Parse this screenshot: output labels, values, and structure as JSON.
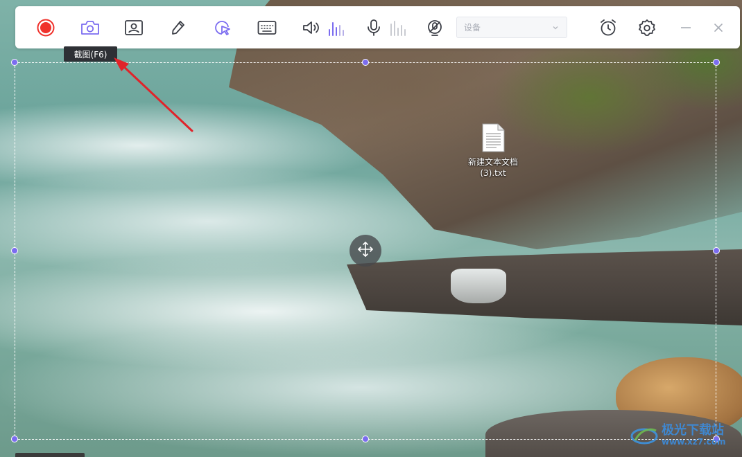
{
  "toolbar": {
    "buttons": [
      {
        "id": "record",
        "icon": "record-icon"
      },
      {
        "id": "screenshot",
        "icon": "camera-icon"
      },
      {
        "id": "webcam",
        "icon": "webcam-icon"
      },
      {
        "id": "draw",
        "icon": "pen-icon"
      },
      {
        "id": "cursor",
        "icon": "cursor-click-icon"
      },
      {
        "id": "keyboard",
        "icon": "keyboard-icon"
      },
      {
        "id": "system_audio",
        "icon": "speaker-icon"
      },
      {
        "id": "microphone",
        "icon": "microphone-icon"
      },
      {
        "id": "mic_device",
        "icon": "mic-disabled-icon"
      },
      {
        "id": "timer",
        "icon": "alarm-clock-icon"
      },
      {
        "id": "settings",
        "icon": "gear-icon"
      },
      {
        "id": "minimize",
        "icon": "minimize-icon"
      },
      {
        "id": "close",
        "icon": "close-icon"
      }
    ],
    "device_select": {
      "value": "设备",
      "icon": "chevron-down-icon"
    },
    "accent_color": "#7b6cf0",
    "record_color": "#f0322c",
    "icon_color": "#3a3d45"
  },
  "tooltip": {
    "text": "截图(F6)"
  },
  "desktop_icon": {
    "filename": "新建文本文档(3).txt",
    "icon": "text-file-icon"
  },
  "watermark": {
    "title": "极光下载站",
    "url": "www.xz7.com"
  },
  "annotation_color": "#e0232a"
}
